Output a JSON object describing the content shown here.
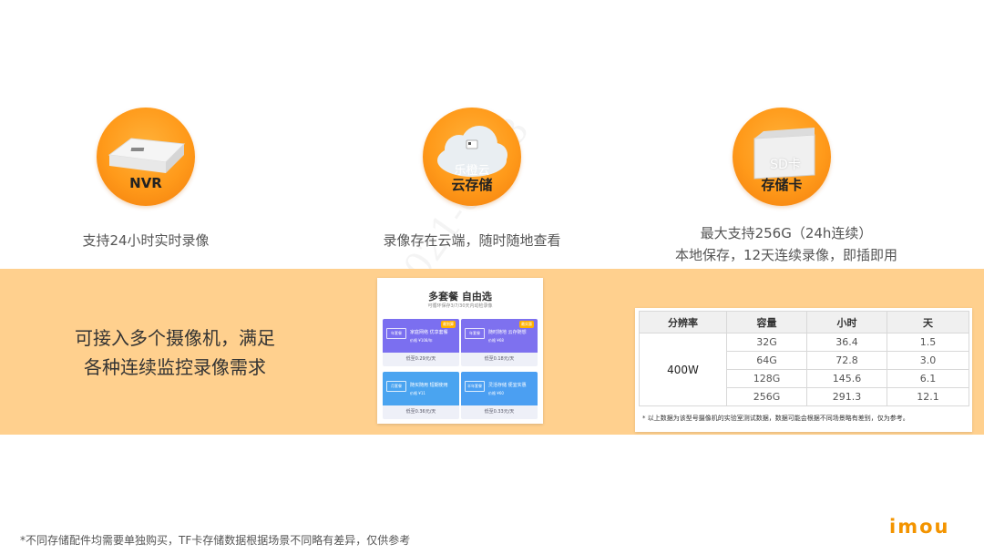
{
  "icons": {
    "nvr": {
      "label": "NVR",
      "caption": "支持24小时实时录像"
    },
    "cloud": {
      "label": "云存储",
      "cloud_text": "乐橙云",
      "caption": "录像存在云端，随时随地查看"
    },
    "sdcard": {
      "label": "存储卡",
      "card_text": "SD卡",
      "caption_line1": "最大支持256G（24h连续）",
      "caption_line2": "本地保存，12天连续录像，即插即用"
    }
  },
  "band": {
    "text_line1": "可接入多个摄像机，满足",
    "text_line2": "各种连续监控录像需求"
  },
  "plan_card": {
    "title": "多套餐 自由选",
    "subtitle": "可循环保存3/7/30天内动检录像",
    "tiles": [
      {
        "tag": "年套餐",
        "name": "家庭网络 优享套餐",
        "price": "价格 ¥108/年",
        "bottom": "低至0.29元/天",
        "badge": "最划算",
        "color": "#7b6ff0"
      },
      {
        "tag": "年套餐",
        "name": "随时随地 云存随想",
        "price": "价格 ¥68",
        "bottom": "低至0.18元/天",
        "badge": "最实惠",
        "color": "#7e71ef"
      },
      {
        "tag": "月套餐",
        "name": "随买随用 短期使用",
        "price": "价格 ¥11",
        "bottom": "低至0.36元/天",
        "badge": "",
        "color": "#4aa4f0"
      },
      {
        "tag": "半年套餐",
        "name": "灵活存储 便宜实惠",
        "price": "价格 ¥60",
        "bottom": "低至0.33元/天",
        "badge": "",
        "color": "#4b9ff2"
      }
    ]
  },
  "spec_table": {
    "headers": [
      "分辨率",
      "容量",
      "小时",
      "天"
    ],
    "resolution": "400W",
    "rows": [
      [
        "32G",
        "36.4",
        "1.5"
      ],
      [
        "64G",
        "72.8",
        "3.0"
      ],
      [
        "128G",
        "145.6",
        "6.1"
      ],
      [
        "256G",
        "291.3",
        "12.1"
      ]
    ],
    "note": "*  以上数据为该型号摄像机的实验室测试数据，数据可能会根据不同场景略有差别，仅为参考。"
  },
  "footnote": "*不同存储配件均需要单独购买，TF卡存储数据根据场景不同略有差异，仅供参考",
  "logo": "imou",
  "watermark": "2021-07-28",
  "colors": {
    "accent": "#f39400",
    "band": "#ffd08e"
  }
}
